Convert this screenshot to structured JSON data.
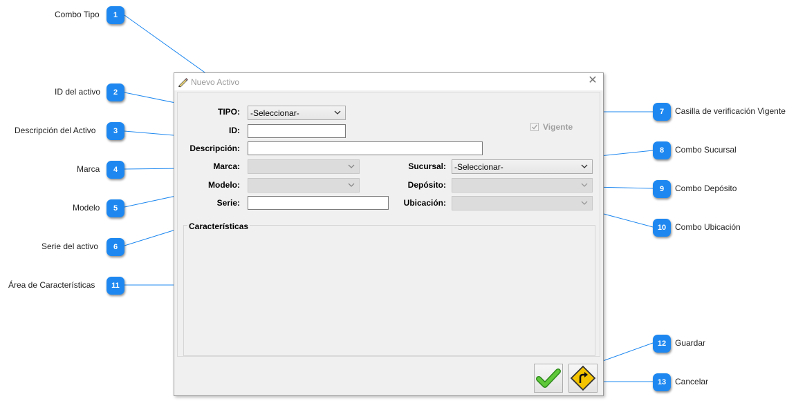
{
  "window": {
    "title": "Nuevo Activo",
    "close_glyph": "✕"
  },
  "form": {
    "tipo_label": "TIPO:",
    "tipo_value": "-Seleccionar-",
    "id_label": "ID:",
    "id_value": "",
    "descripcion_label": "Descripción:",
    "descripcion_value": "",
    "marca_label": "Marca:",
    "marca_value": "",
    "modelo_label": "Modelo:",
    "modelo_value": "",
    "serie_label": "Serie:",
    "serie_value": "",
    "vigente_label": "Vigente",
    "vigente_checked": true,
    "sucursal_label": "Sucursal:",
    "sucursal_value": "-Seleccionar-",
    "deposito_label": "Depósito:",
    "deposito_value": "",
    "ubicacion_label": "Ubicación:",
    "ubicacion_value": "",
    "caracteristicas_label": "Características"
  },
  "buttons": {
    "guardar_icon": "green-check-icon",
    "cancelar_icon": "return-arrow-sign-icon"
  },
  "callouts": [
    {
      "num": "1",
      "label": "Combo Tipo"
    },
    {
      "num": "2",
      "label": "ID del activo"
    },
    {
      "num": "3",
      "label": "Descripción del Activo"
    },
    {
      "num": "4",
      "label": "Marca"
    },
    {
      "num": "5",
      "label": "Modelo"
    },
    {
      "num": "6",
      "label": "Serie del activo"
    },
    {
      "num": "7",
      "label": "Casilla de verificación Vigente"
    },
    {
      "num": "8",
      "label": "Combo Sucursal"
    },
    {
      "num": "9",
      "label": "Combo Depósito"
    },
    {
      "num": "10",
      "label": "Combo Ubicación"
    },
    {
      "num": "11",
      "label": "Área de Características"
    },
    {
      "num": "12",
      "label": "Guardar"
    },
    {
      "num": "13",
      "label": "Cancelar"
    }
  ],
  "colors": {
    "badge": "#1e88f0",
    "leader_line": "#1e88f0",
    "check_green": "#3fa828",
    "sign_yellow": "#f5c400"
  }
}
